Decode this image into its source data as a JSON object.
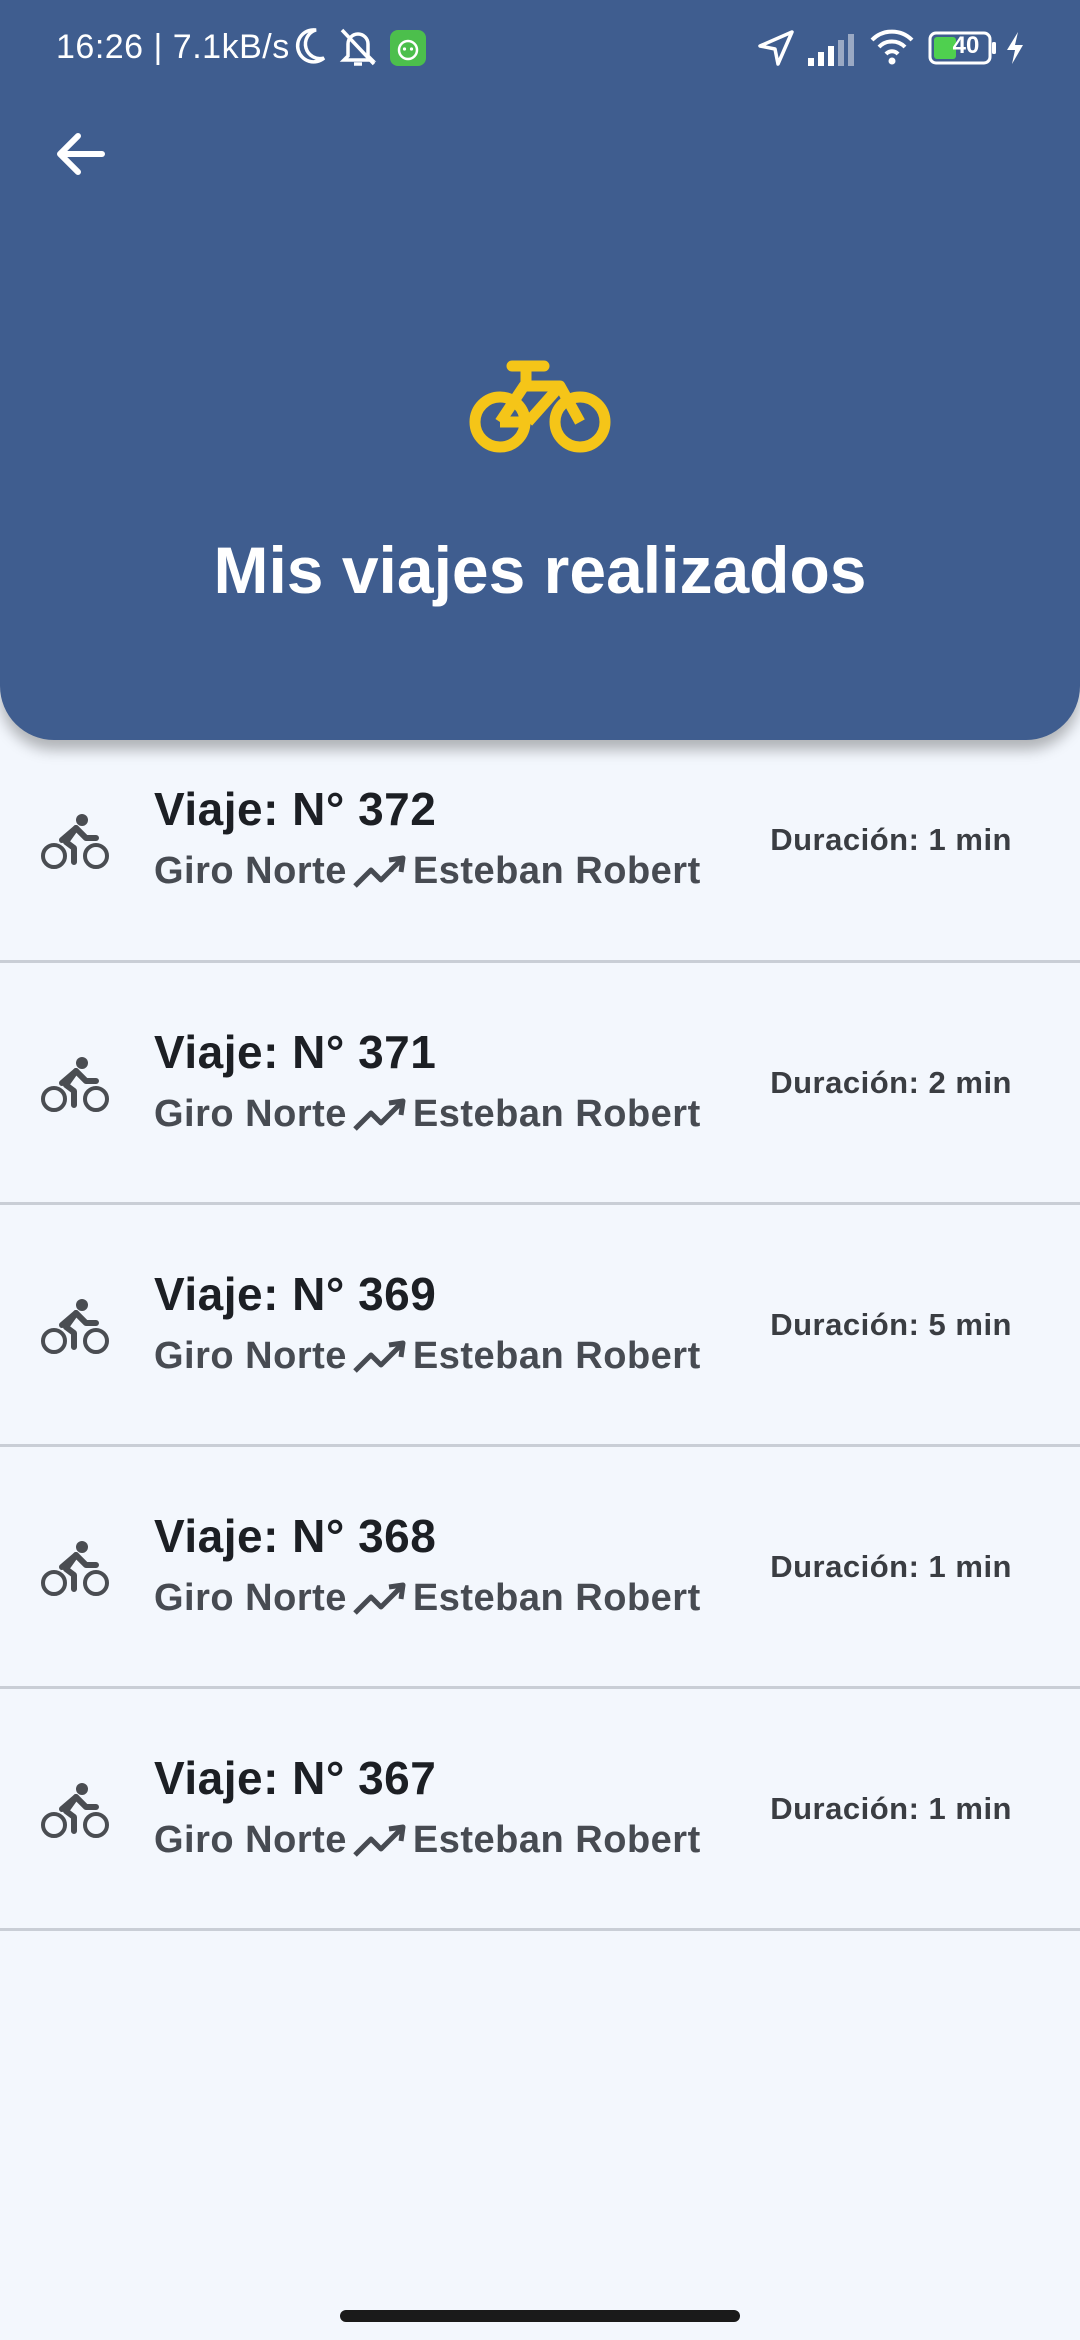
{
  "status_bar": {
    "time_speed": "16:26 | 7.1kB/s",
    "battery": "40",
    "icons": [
      "moon-icon",
      "bell-off-icon",
      "android-app-icon",
      "location-arrow-icon",
      "signal-icon",
      "wifi-icon",
      "battery-icon",
      "charging-icon"
    ]
  },
  "header": {
    "title": "Mis viajes realizados",
    "back_icon": "arrow-left-icon",
    "logo_icon": "bicycle-icon",
    "logo_color": "#f5c518",
    "background": "#3f5d8f"
  },
  "trips": [
    {
      "title": "Viaje: N° 372",
      "from": "Giro Norte",
      "to": "Esteban Robert",
      "duration": "Duración: 1 min"
    },
    {
      "title": "Viaje: N° 371",
      "from": "Giro Norte",
      "to": "Esteban Robert",
      "duration": "Duración: 2 min"
    },
    {
      "title": "Viaje: N° 369",
      "from": "Giro Norte",
      "to": "Esteban Robert",
      "duration": "Duración: 5 min"
    },
    {
      "title": "Viaje: N° 368",
      "from": "Giro Norte",
      "to": "Esteban Robert",
      "duration": "Duración: 1 min"
    },
    {
      "title": "Viaje: N° 367",
      "from": "Giro Norte",
      "to": "Esteban Robert",
      "duration": "Duración: 1 min"
    }
  ]
}
